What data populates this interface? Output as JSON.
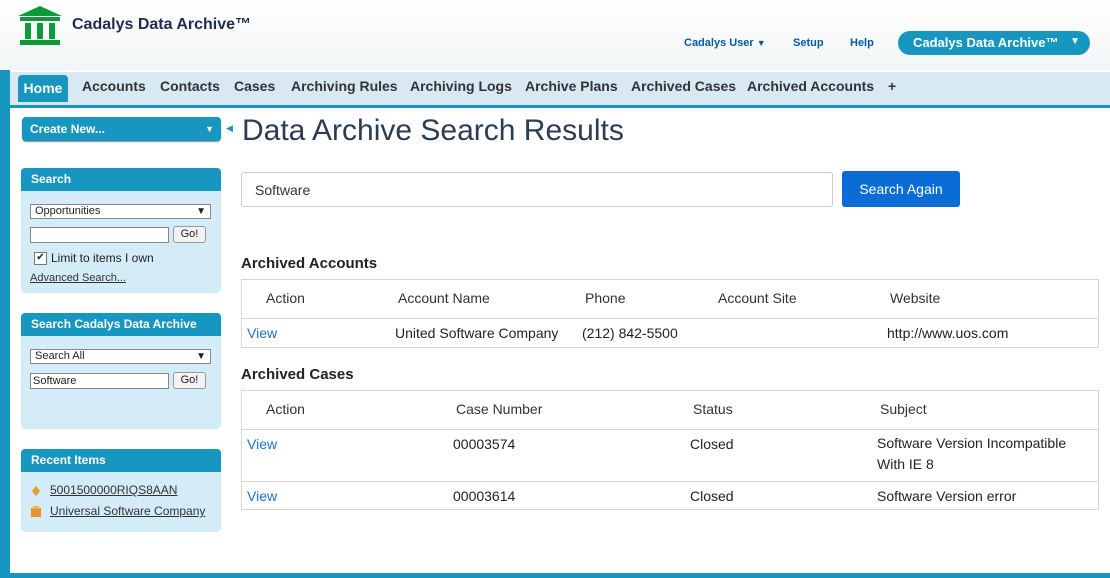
{
  "header": {
    "app_title": "Cadalys Data Archive™",
    "user_menu": "Cadalys User",
    "setup": "Setup",
    "help": "Help",
    "app_menu": "Cadalys Data Archive™"
  },
  "tabs": [
    {
      "label": "Home",
      "active": true
    },
    {
      "label": "Accounts"
    },
    {
      "label": "Contacts"
    },
    {
      "label": "Cases"
    },
    {
      "label": "Archiving Rules"
    },
    {
      "label": "Archiving Logs"
    },
    {
      "label": "Archive Plans"
    },
    {
      "label": "Archived Cases"
    },
    {
      "label": "Archived Accounts"
    },
    {
      "label": "+"
    }
  ],
  "sidebar": {
    "create_new": "Create New...",
    "search": {
      "title": "Search",
      "select_value": "Opportunities",
      "input_value": "",
      "go": "Go!",
      "limit_label": "Limit to items I own",
      "limit_checked": true,
      "advanced": "Advanced Search..."
    },
    "archive_search": {
      "title": "Search Cadalys Data Archive",
      "select_value": "Search All",
      "input_value": "Software",
      "go": "Go!"
    },
    "recent": {
      "title": "Recent Items",
      "items": [
        {
          "label": "5001500000RIQS8AAN",
          "icon": "case-icon"
        },
        {
          "label": "Universal Software Company",
          "icon": "account-icon"
        }
      ]
    }
  },
  "main": {
    "title": "Data Archive Search Results",
    "search_value": "Software",
    "search_again": "Search Again",
    "accounts": {
      "title": "Archived Accounts",
      "columns": [
        "Action",
        "Account Name",
        "Phone",
        "Account Site",
        "Website"
      ],
      "rows": [
        [
          "View",
          "United Software Company",
          "(212) 842-5500",
          "",
          "http://www.uos.com"
        ]
      ]
    },
    "cases": {
      "title": "Archived Cases",
      "columns": [
        "Action",
        "Case Number",
        "Status",
        "Subject"
      ],
      "rows": [
        [
          "View",
          "00003574",
          "Closed",
          "Software Version Incompatible With IE 8"
        ],
        [
          "View",
          "00003614",
          "Closed",
          "Software Version error"
        ]
      ]
    }
  },
  "colors": {
    "accent": "#1797c0",
    "tab_bar": "#d8e9f4",
    "panel": "#d3ecf7",
    "button": "#0a6cd4",
    "link": "#1a72c7"
  }
}
